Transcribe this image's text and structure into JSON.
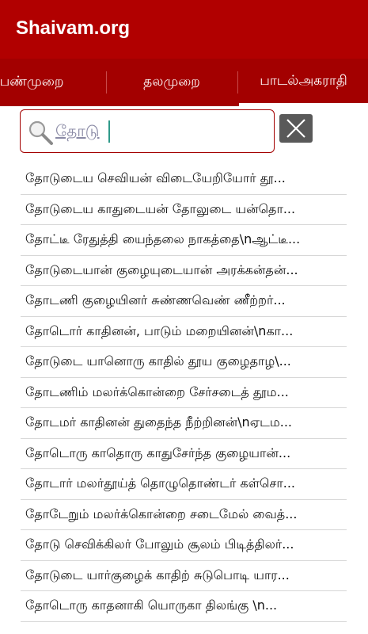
{
  "app": {
    "title": "Shaivam.org"
  },
  "tabs": [
    {
      "label": "பண்முறை"
    },
    {
      "label": "தலமுறை"
    },
    {
      "label": "பாடல்அகராதி"
    }
  ],
  "search": {
    "value": "தோடு"
  },
  "results": [
    "தோடுடைய செவியன் விடையேறியோர் தூ...",
    "தோடுடைய காதுடையன் தோலுடை யன்தொ...",
    "தோட்டீ ரேதுத்தி யைந்தலை நாகத்தை\\nஆட்டீ...",
    "தோடுடையான் குழையுடையான் அரக்கன்தன்...",
    "தோடணி குழையினர் சுண்ணவெண் ணீற்றர்...",
    "தோடொர் காதினன், பாடும் மறையினன்\\nகா...",
    "தோடுடை யானொரு காதில் தூய குழைதாழ\\...",
    "தோடணிம் மலர்க்கொன்றை சேர்சடைத் தூம...",
    "தோடமர் காதினன் துதைந்த நீற்றினன்\\nஏடம...",
    "தோடொரு காதொரு காதுசேர்ந்த குழையான்...",
    "தோடார் மலர்தூய்த் தொழுதொண்டர் கள்சொ...",
    "தோடேறும் மலர்க்கொன்றை சடைமேல் வைத்...",
    "தோடு செவிக்கிலர் போலும் சூலம் பிடித்திலர்...",
    "தோடுடை யார்குழைக் காதிற் சுடுபொடி யார...",
    "தோடொரு காதனாகி யொருகா திலங்கு     \\n..."
  ],
  "colors": {
    "appbar": "#b10000",
    "tabbar": "#a30000",
    "clear_button": "#595959"
  }
}
